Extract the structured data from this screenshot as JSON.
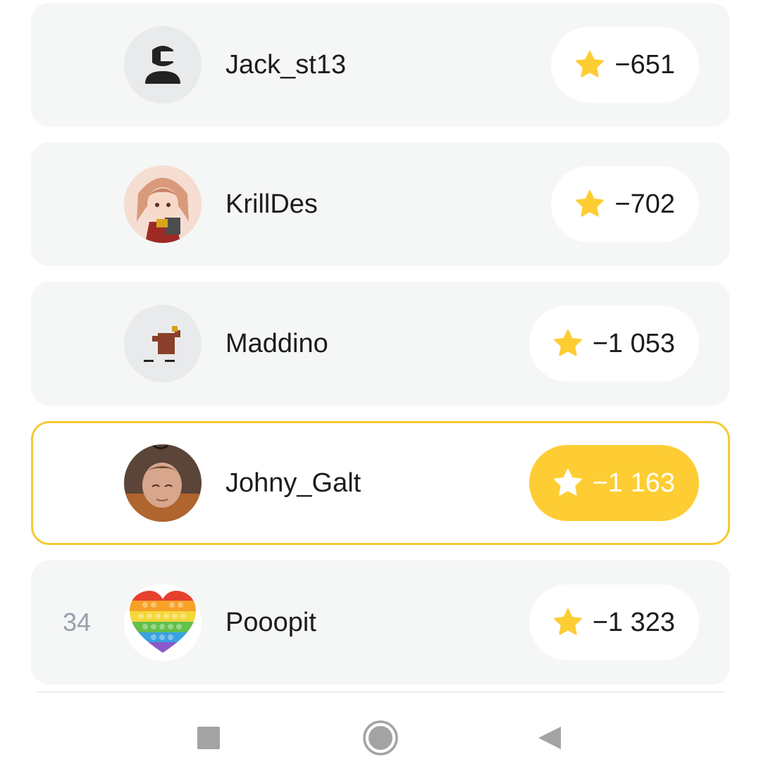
{
  "colors": {
    "accent": "#fdcd33",
    "card_background": "#f5f6f6",
    "current_user_border": "#f5c930",
    "rank_text": "#98a0aa"
  },
  "leaderboard": {
    "rows": [
      {
        "rank": "",
        "username": "Jack_st13",
        "score": "−651",
        "avatar": "default-person-avatar"
      },
      {
        "rank": "",
        "username": "KrillDes",
        "score": "−702",
        "avatar": "anime-girl-avatar"
      },
      {
        "rank": "",
        "username": "Maddino",
        "score": "−1 053",
        "avatar": "pixel-figure-avatar"
      },
      {
        "rank": "",
        "username": "Johny_Galt",
        "score": "−1 163",
        "avatar": "photo-man-avatar",
        "current_user": true
      },
      {
        "rank": "34",
        "username": "Pooopit",
        "score": "−1 323",
        "avatar": "rainbow-pop-it-heart-avatar"
      }
    ]
  },
  "navbar": {
    "buttons": [
      "recents-square-icon",
      "home-circle-icon",
      "back-triangle-icon"
    ]
  }
}
